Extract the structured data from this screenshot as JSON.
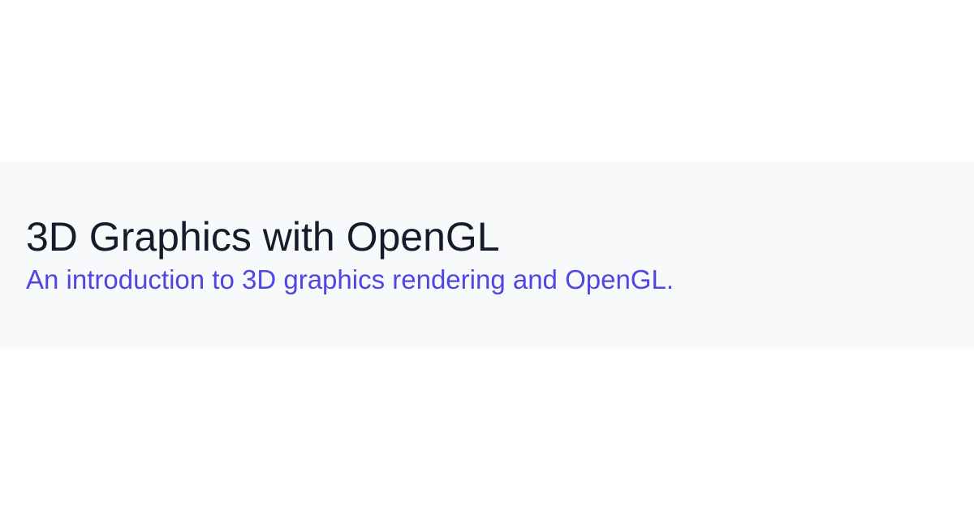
{
  "card": {
    "title": "3D Graphics with OpenGL",
    "subtitle": "An introduction to 3D graphics rendering and OpenGL."
  },
  "colors": {
    "page_background": "#ffffff",
    "banner_background": "#f8f9fa",
    "title": "#161c2b",
    "subtitle_accent": "#4f46e5"
  }
}
